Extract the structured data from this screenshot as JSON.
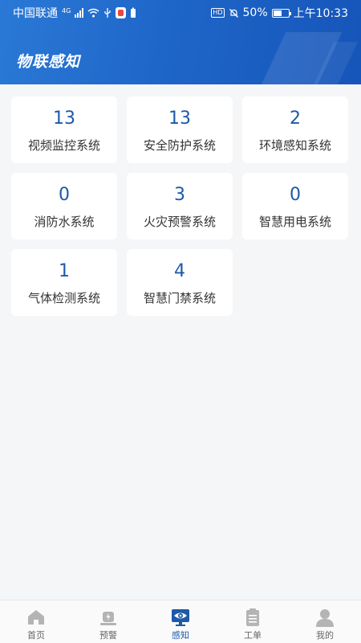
{
  "status_bar": {
    "carrier": "中国联通",
    "network": "4G",
    "battery_percent": "50%",
    "time": "上午10:33"
  },
  "header": {
    "title": "物联感知"
  },
  "systems": [
    {
      "count": "13",
      "label": "视频监控系统"
    },
    {
      "count": "13",
      "label": "安全防护系统"
    },
    {
      "count": "2",
      "label": "环境感知系统"
    },
    {
      "count": "0",
      "label": "消防水系统"
    },
    {
      "count": "3",
      "label": "火灾预警系统"
    },
    {
      "count": "0",
      "label": "智慧用电系统"
    },
    {
      "count": "1",
      "label": "气体检测系统"
    },
    {
      "count": "4",
      "label": "智慧门禁系统"
    }
  ],
  "tabbar": {
    "items": [
      {
        "label": "首页",
        "icon": "home-icon"
      },
      {
        "label": "预警",
        "icon": "alert-icon"
      },
      {
        "label": "感知",
        "icon": "eye-monitor-icon"
      },
      {
        "label": "工单",
        "icon": "clipboard-icon"
      },
      {
        "label": "我的",
        "icon": "user-icon"
      }
    ],
    "active_index": 2
  },
  "colors": {
    "header_blue": "#1f66c9",
    "accent": "#1d5aa8",
    "inactive_icon": "#b4b4b4"
  }
}
